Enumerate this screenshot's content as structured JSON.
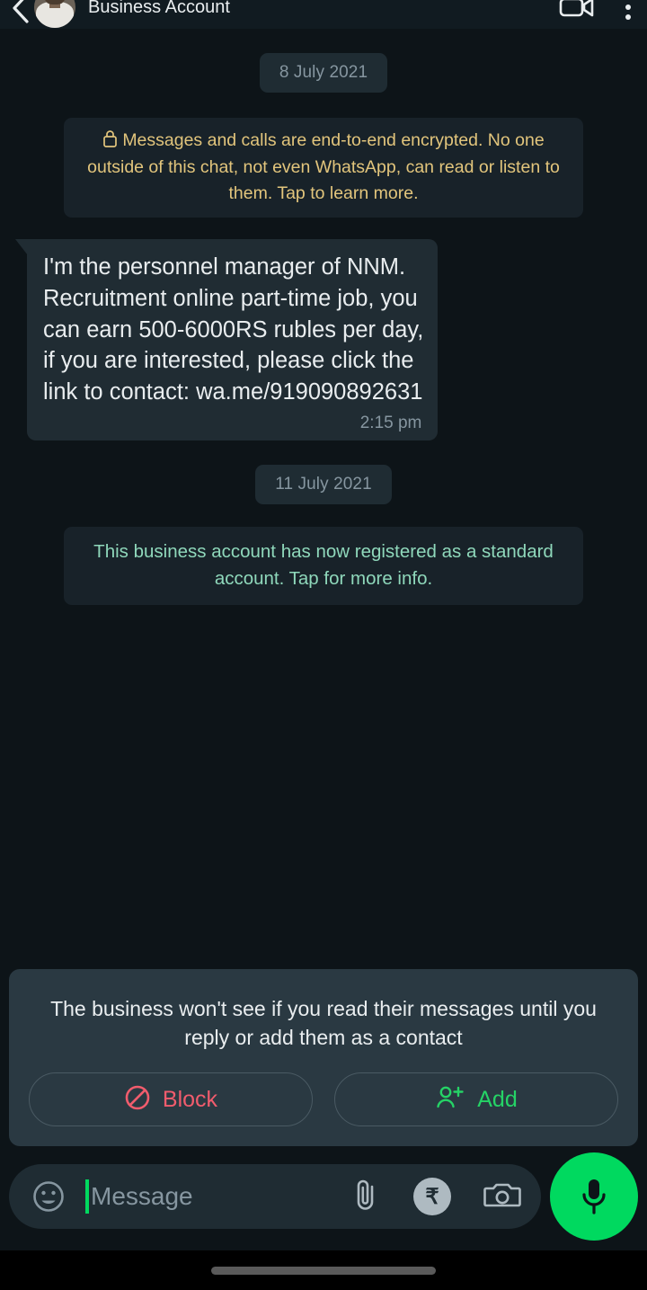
{
  "header": {
    "title": "Business Account",
    "back_icon": "back-arrow-icon",
    "avatar_alt": "contact-avatar",
    "video_call_icon": "video-call-icon",
    "overflow_icon": "overflow-menu-icon"
  },
  "chat": {
    "date_1": "8 July 2021",
    "encryption_notice": "Messages and calls are end-to-end encrypted. No one outside of this chat, not even WhatsApp, can read or listen to them. Tap to learn more.",
    "lock_icon": "lock-icon",
    "message": {
      "text": "I'm the personnel  manager of  NNM.\nRecruitment  online part-time  job,  you\ncan earn  500-6000RS rubles  per  day,\nif you are  interested,  please click  the\nlink  to contact: wa.me/919090892631",
      "time": "2:15 pm"
    },
    "date_2": "11 July 2021",
    "system_notice": "This business account has now registered as a standard account. Tap for more info."
  },
  "business_panel": {
    "info_text": "The business won't see if you read their messages until you reply or add them as a contact",
    "block_label": "Block",
    "block_icon": "block-circle-slash-icon",
    "add_label": "Add",
    "add_icon": "person-add-icon"
  },
  "input_bar": {
    "placeholder": "Message",
    "emoji_icon": "emoji-smiley-icon",
    "attach_icon": "paperclip-icon",
    "payment_icon": "rupee-icon",
    "payment_symbol": "₹",
    "camera_icon": "camera-icon",
    "mic_icon": "microphone-icon"
  },
  "colors": {
    "chat_background": "#0d1418",
    "bubble": "#202c33",
    "encryption_text": "#e2c57c",
    "system_text": "#8fd8bb",
    "block_accent": "#f15c6d",
    "add_accent": "#25d366",
    "mic_accent": "#00d95f",
    "panel": "#2a3942"
  }
}
